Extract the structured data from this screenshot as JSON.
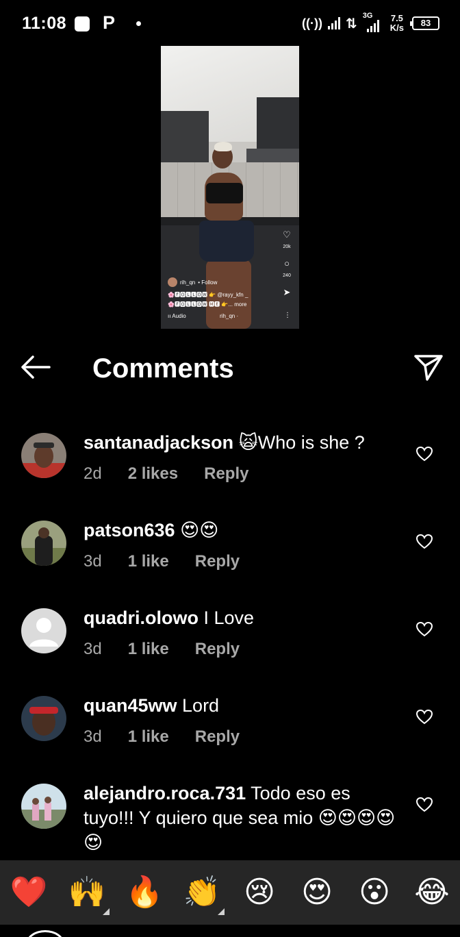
{
  "status_bar": {
    "time": "11:08",
    "app_letter": "P",
    "network_3g": "3G",
    "speed_value": "7.5",
    "speed_unit": "K/s",
    "battery": "83"
  },
  "video": {
    "likes_count": "20k",
    "comments_count": "240",
    "username": "rih_qn",
    "follow_label": "• Follow",
    "caption_line1": "🌸🅵🅾🅻🅻🅾🆆 👉 @rayy_kfn _",
    "caption_line2": "🌸🅵🅾🅻🅻🅾🆆 🅼🅴 👉... more",
    "audio_label": "ıı Audio",
    "audio_user": "rih_qn ·"
  },
  "header": {
    "title": "Comments"
  },
  "comments": [
    {
      "username": "santanadjackson",
      "text": " 🙀Who is she ?",
      "time": "2d",
      "likes": "2 likes",
      "reply": "Reply"
    },
    {
      "username": "patson636",
      "text": " 😍😍",
      "time": "3d",
      "likes": "1 like",
      "reply": "Reply"
    },
    {
      "username": "quadri.olowo",
      "text": " I Love",
      "time": "3d",
      "likes": "1 like",
      "reply": "Reply"
    },
    {
      "username": "quan45ww",
      "text": " Lord",
      "time": "3d",
      "likes": "1 like",
      "reply": "Reply"
    },
    {
      "username": "alejandro.roca.731",
      "text": " Todo eso es tuyo!!! Y quiero que sea mio 😍😍😍😍😍",
      "time": "",
      "likes": "",
      "reply": ""
    }
  ],
  "reactions": [
    "❤️",
    "🙌",
    "🔥",
    "👏",
    "😢",
    "😍",
    "😮",
    "😂"
  ],
  "colors": {
    "background": "#000000",
    "reaction_bar": "#262626",
    "meta_text": "#a8a8a8"
  }
}
